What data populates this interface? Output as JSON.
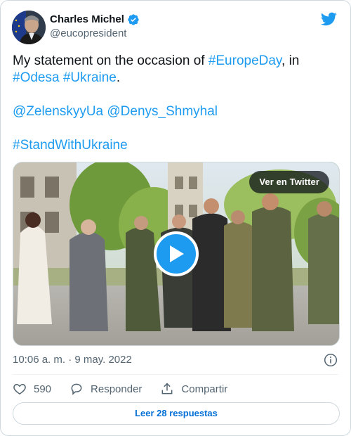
{
  "author": {
    "display_name": "Charles Michel",
    "handle": "@eucopresident"
  },
  "tweet": {
    "line1_text": "My statement on the occasion of ",
    "line1_tag": "#EuropeDay",
    "line1_suffix": ", in",
    "line2_tag1": "#Odesa",
    "line2_tag2": "#Ukraine",
    "line2_suffix": ".",
    "mention1": "@ZelenskyyUa",
    "mention2": "@Denys_Shmyhal",
    "hashtag_final": "#StandWithUkraine"
  },
  "media": {
    "view_button": "Ver en Twitter"
  },
  "meta": {
    "timestamp": "10:06 a. m. · 9 may. 2022"
  },
  "actions": {
    "like_count": "590",
    "reply_label": "Responder",
    "share_label": "Compartir"
  },
  "read_replies": "Leer 28 respuestas",
  "colors": {
    "accent": "#1d9bf0",
    "link": "#006fd6",
    "text": "#0f1419",
    "muted": "#536471",
    "border": "#cfd9de"
  }
}
